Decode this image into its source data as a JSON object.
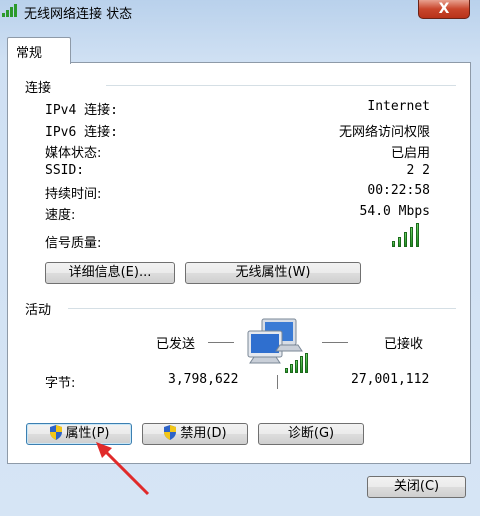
{
  "window": {
    "title": "无线网络连接 状态",
    "close_glyph": "X"
  },
  "tab": {
    "label": "常规"
  },
  "connection": {
    "group_label": "连接",
    "rows": [
      {
        "label": "IPv4 连接:",
        "value": "Internet"
      },
      {
        "label": "IPv6 连接:",
        "value": "无网络访问权限"
      },
      {
        "label": "媒体状态:",
        "value": "已启用"
      },
      {
        "label": "SSID:",
        "value": "2 2"
      },
      {
        "label": "持续时间:",
        "value": "00:22:58"
      },
      {
        "label": "速度:",
        "value": "54.0 Mbps"
      },
      {
        "label": "信号质量:",
        "value": ""
      }
    ],
    "signal_bars_level": 5,
    "details_button": "详细信息(E)...",
    "wireless_props_button": "无线属性(W)"
  },
  "activity": {
    "group_label": "活动",
    "sent_label": "已发送",
    "received_label": "已接收",
    "bytes_label": "字节:",
    "sent_bytes": "3,798,622",
    "received_bytes": "27,001,112"
  },
  "buttons": {
    "properties": "属性(P)",
    "disable": "禁用(D)",
    "diagnose": "诊断(G)",
    "close": "关闭(C)"
  },
  "icons": {
    "title": "wifi-signal-icon",
    "network": "network-computers-icon",
    "uac": "uac-shield-icon"
  }
}
